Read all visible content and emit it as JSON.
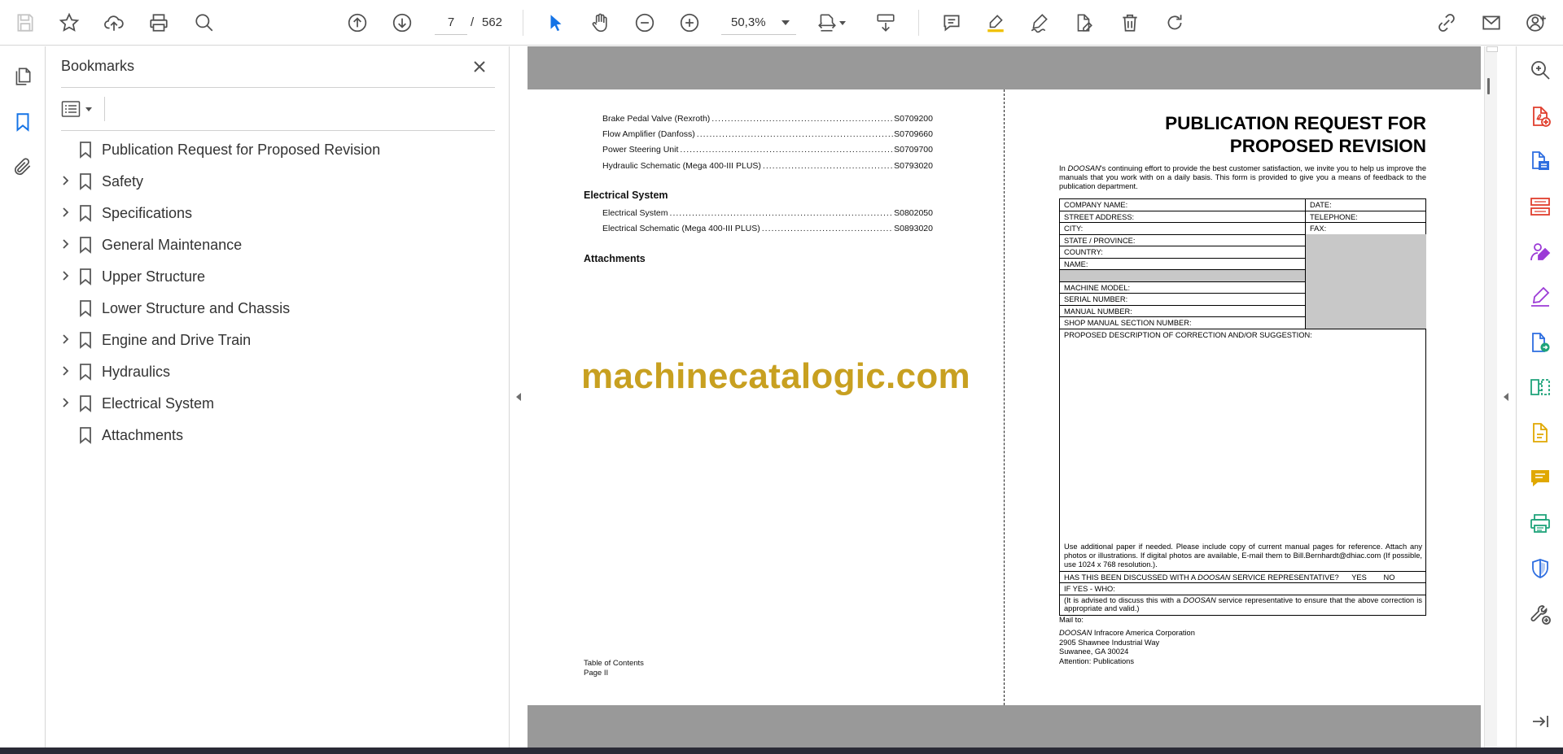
{
  "toolbar": {
    "page_current": "7",
    "page_separator": "/",
    "page_total": "562",
    "zoom": "50,3%",
    "icons": [
      "save-icon",
      "star-icon",
      "cloud-upload-icon",
      "print-icon",
      "find-icon",
      "prev-page-icon",
      "next-page-icon",
      "select-arrow-icon",
      "hand-icon",
      "zoom-out-icon",
      "zoom-in-icon",
      "fit-page-icon",
      "scroll-mode-icon",
      "comment-icon",
      "highlight-icon",
      "sign-icon",
      "edit-pdf-icon",
      "delete-icon",
      "rotate-icon",
      "share-link-icon",
      "email-icon",
      "account-icon"
    ]
  },
  "bookmarks": {
    "title": "Bookmarks",
    "items": [
      {
        "label": "Publication Request for Proposed Revision",
        "expandable": false
      },
      {
        "label": "Safety",
        "expandable": true
      },
      {
        "label": "Specifications",
        "expandable": true
      },
      {
        "label": "General Maintenance",
        "expandable": true
      },
      {
        "label": "Upper Structure",
        "expandable": true
      },
      {
        "label": "Lower Structure and Chassis",
        "expandable": false
      },
      {
        "label": "Engine and Drive Train",
        "expandable": true
      },
      {
        "label": "Hydraulics",
        "expandable": true
      },
      {
        "label": "Electrical System",
        "expandable": true
      },
      {
        "label": "Attachments",
        "expandable": false
      }
    ]
  },
  "left_page": {
    "toc": [
      {
        "title": "Brake Pedal Valve (Rexroth)",
        "code": "S0709200"
      },
      {
        "title": "Flow Amplifier (Danfoss)",
        "code": "S0709660"
      },
      {
        "title": "Power Steering Unit",
        "code": "S0709700"
      },
      {
        "title": "Hydraulic Schematic (Mega 400-III PLUS)",
        "code": "S0793020"
      }
    ],
    "section_electrical": "Electrical System",
    "toc_electrical": [
      {
        "title": "Electrical System",
        "code": "S0802050"
      },
      {
        "title": "Electrical Schematic (Mega 400-III PLUS)",
        "code": "S0893020"
      }
    ],
    "section_attachments": "Attachments",
    "watermark": "machinecatalogic.com",
    "footer_line1": "Table of Contents",
    "footer_line2": "Page II"
  },
  "right_page": {
    "title_line1": "PUBLICATION REQUEST FOR",
    "title_line2": "PROPOSED REVISION",
    "intro_prefix": "In ",
    "intro_brand": "DOOSAN",
    "intro_text": "'s continuing effort to provide the best customer satisfaction, we invite you to help us improve the manuals that you work with on a daily basis. This form is provided to give you a means of feedback to the publication department.",
    "fields": {
      "company": "COMPANY NAME:",
      "date": "DATE:",
      "street": "STREET ADDRESS:",
      "telephone": "TELEPHONE:",
      "city": "CITY:",
      "fax": "FAX:",
      "state": "STATE / PROVINCE:",
      "country": "COUNTRY:",
      "name": "NAME:",
      "machine_model": "MACHINE MODEL:",
      "serial": "SERIAL NUMBER:",
      "manual": "MANUAL NUMBER:",
      "shop_section": "SHOP MANUAL SECTION NUMBER:",
      "proposed": "PROPOSED DESCRIPTION OF CORRECTION AND/OR SUGGESTION:",
      "note": "Use additional paper if needed. Please include copy of current manual pages for reference. Attach any photos or illustrations. If digital photos are available, E-mail them to Bill.Bernhardt@dhiac.com (If possible, use 1024 x 768 resolution.).",
      "discussed_prefix": "HAS THIS BEEN DISCUSSED WITH A ",
      "discussed_brand": "DOOSAN",
      "discussed_suffix": " SERVICE REPRESENTATIVE?",
      "yes": "YES",
      "no": "NO",
      "if_yes": "IF YES - WHO:",
      "advise_prefix": "(It is advised to discuss this with a ",
      "advise_brand": "DOOSAN",
      "advise_suffix": " service representative to ensure that the above correction is appropriate and valid.)"
    },
    "mail_to": "Mail to:",
    "mail_brand": "DOOSAN",
    "mail_line1": " Infracore America Corporation",
    "mail_line2": "2905 Shawnee Industrial Way",
    "mail_line3": "Suwanee, GA 30024",
    "mail_line4": "Attention: Publications"
  },
  "right_tools": [
    "search-tool-icon",
    "create-pdf-icon",
    "export-pdf-icon",
    "organize-pages-icon",
    "request-signatures-icon",
    "fill-sign-icon",
    "send-for-review-icon",
    "compare-files-icon",
    "edit-pdf-tool-icon",
    "comment-tool-icon",
    "print-production-icon",
    "protect-icon",
    "more-tools-icon",
    "collapse-panel-icon"
  ]
}
